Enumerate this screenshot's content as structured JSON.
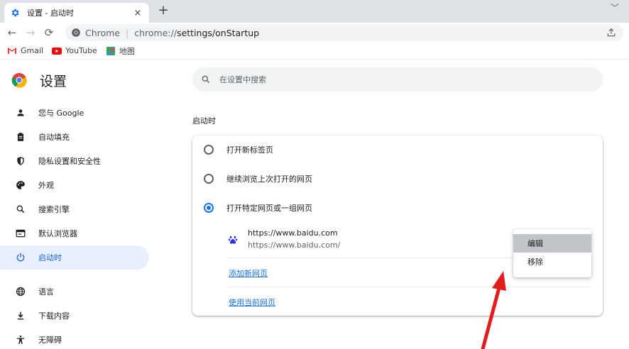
{
  "tab": {
    "title": "设置 - 启动时",
    "icon": "gear-icon",
    "close": "×"
  },
  "new_tab": "+",
  "tab_menu": "﹀",
  "toolbar": {
    "back": "←",
    "forward": "→",
    "reload": "⟳",
    "site_label": "Chrome",
    "url_host": "chrome://",
    "url_path": "settings/onStartup"
  },
  "bookmarks": [
    {
      "label": "Gmail",
      "icon": "gmail-icon"
    },
    {
      "label": "YouTube",
      "icon": "youtube-icon"
    },
    {
      "label": "地图",
      "icon": "maps-icon"
    }
  ],
  "settings": {
    "title": "设置",
    "search_placeholder": "在设置中搜索"
  },
  "sidebar": {
    "items": [
      {
        "label": "您与 Google",
        "icon": "person-icon"
      },
      {
        "label": "自动填充",
        "icon": "clipboard-icon"
      },
      {
        "label": "隐私设置和安全性",
        "icon": "shield-icon"
      },
      {
        "label": "外观",
        "icon": "palette-icon"
      },
      {
        "label": "搜索引擎",
        "icon": "search-icon"
      },
      {
        "label": "默认浏览器",
        "icon": "browser-icon"
      },
      {
        "label": "启动时",
        "icon": "power-icon",
        "active": true
      },
      {
        "label": "语言",
        "icon": "globe-icon"
      },
      {
        "label": "下载内容",
        "icon": "download-icon"
      },
      {
        "label": "无障碍",
        "icon": "accessibility-icon"
      }
    ]
  },
  "main": {
    "section_title": "启动时",
    "options": [
      {
        "label": "打开新标签页",
        "checked": false
      },
      {
        "label": "继续浏览上次打开的网页",
        "checked": false
      },
      {
        "label": "打开特定网页或一组网页",
        "checked": true
      }
    ],
    "site": {
      "name": "https://www.baidu.com",
      "url": "https://www.baidu.com/",
      "icon": "baidu-paw-icon"
    },
    "add_page": "添加新网页",
    "use_current": "使用当前网页"
  },
  "context_menu": {
    "items": [
      {
        "label": "编辑",
        "highlighted": true
      },
      {
        "label": "移除",
        "highlighted": false
      }
    ]
  },
  "colors": {
    "accent": "#1a73e8",
    "active_bg": "#e8f0fe",
    "arrow": "#e11d1d"
  }
}
